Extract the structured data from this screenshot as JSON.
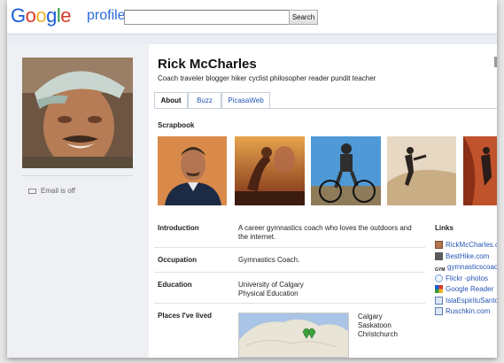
{
  "header": {
    "logo_letters": [
      "G",
      "o",
      "o",
      "g",
      "l",
      "e"
    ],
    "product": "profiles",
    "search_value": "",
    "search_button": "Search"
  },
  "sidebar": {
    "email_status": "Email is off"
  },
  "profile": {
    "name": "Rick McCharles",
    "tagline": "Coach traveler blogger hiker cyclist philosopher reader pundit teacher"
  },
  "tabs": [
    {
      "label": "About",
      "active": true
    },
    {
      "label": "Buzz",
      "active": false
    },
    {
      "label": "PicasaWeb",
      "active": false
    }
  ],
  "scrapbook": {
    "label": "Scrapbook"
  },
  "about_rows": [
    {
      "label": "Introduction",
      "value": "A career gymnastics coach who loves the outdoors and the internet."
    },
    {
      "label": "Occupation",
      "value": "Gymnastics Coach."
    },
    {
      "label": "Education",
      "value_lines": [
        "University of Calgary",
        "Physical Education"
      ]
    },
    {
      "label": "Places I've lived",
      "value_lines": [
        "Calgary",
        "Saskatoon",
        "Christchurch"
      ]
    }
  ],
  "links": {
    "title": "Links",
    "items": [
      {
        "label": "RickMcCharles.c",
        "icon": "avatar-icon"
      },
      {
        "label": "BestHike.com",
        "icon": "besthike-icon"
      },
      {
        "label": "gymnasticscoac",
        "icon": "gym-icon",
        "icon_text": "GYM"
      },
      {
        "label": "Flickr -photos",
        "icon": "flickr-icon"
      },
      {
        "label": "Google Reader",
        "icon": "google-reader-icon"
      },
      {
        "label": "IslaEspirituSanto",
        "icon": "globe-icon"
      },
      {
        "label": "Ruschkin.com",
        "icon": "globe-icon"
      }
    ]
  },
  "colors": {
    "link": "#2455b5",
    "brand_blue": "#1b5bd6",
    "header_band": "#eaeef4"
  }
}
